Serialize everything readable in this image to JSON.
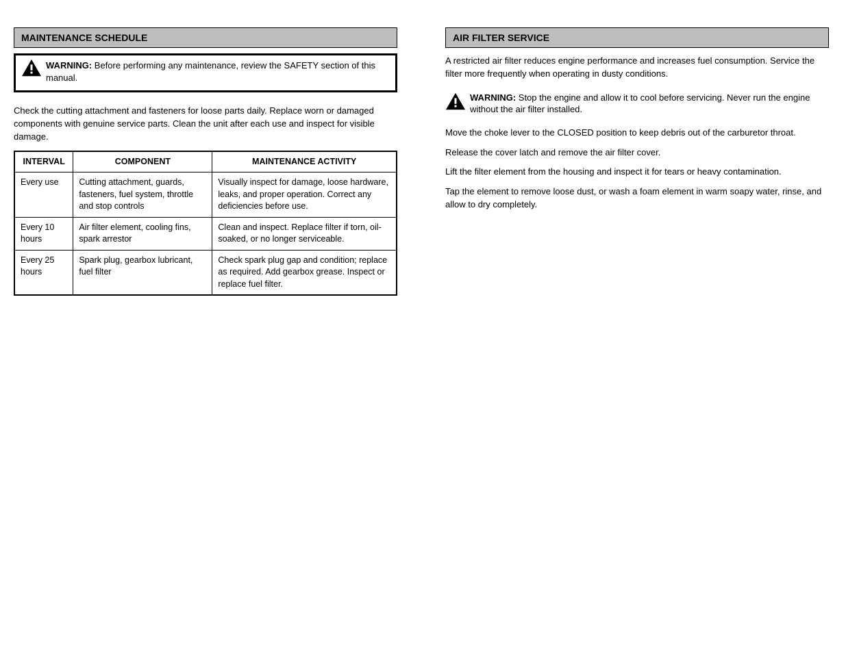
{
  "left": {
    "sectionTitle": "MAINTENANCE SCHEDULE",
    "warning": {
      "label": "WARNING:",
      "text": "Before performing any maintenance, review the SAFETY section of this manual."
    },
    "intro": "Check the cutting attachment and fasteners for loose parts daily. Replace worn or damaged components with genuine service parts. Clean the unit after each use and inspect for visible damage.",
    "table": {
      "headers": [
        "INTERVAL",
        "COMPONENT",
        "MAINTENANCE ACTIVITY"
      ],
      "rows": [
        {
          "interval": "Every use",
          "component": "Cutting attachment, guards, fasteners, fuel system, throttle and stop controls",
          "activity": "Visually inspect for damage, loose hardware, leaks, and proper operation. Correct any deficiencies before use."
        },
        {
          "interval": "Every 10 hours",
          "component": "Air filter element, cooling fins, spark arrestor",
          "activity": "Clean and inspect. Replace filter if torn, oil-soaked, or no longer serviceable."
        },
        {
          "interval": "Every 25 hours",
          "component": "Spark plug, gearbox lubricant, fuel filter",
          "activity": "Check spark plug gap and condition; replace as required. Add gearbox grease. Inspect or replace fuel filter."
        }
      ]
    }
  },
  "right": {
    "sectionTitle": "AIR FILTER SERVICE",
    "intro": "A restricted air filter reduces engine performance and increases fuel consumption. Service the filter more frequently when operating in dusty conditions.",
    "warning": {
      "label": "WARNING:",
      "text": "Stop the engine and allow it to cool before servicing. Never run the engine without the air filter installed."
    },
    "steps": [
      "Move the choke lever to the CLOSED position to keep debris out of the carburetor throat.",
      "Release the cover latch and remove the air filter cover.",
      "Lift the filter element from the housing and inspect it for tears or heavy contamination.",
      "Tap the element to remove loose dust, or wash a foam element in warm soapy water, rinse, and allow to dry completely."
    ]
  }
}
